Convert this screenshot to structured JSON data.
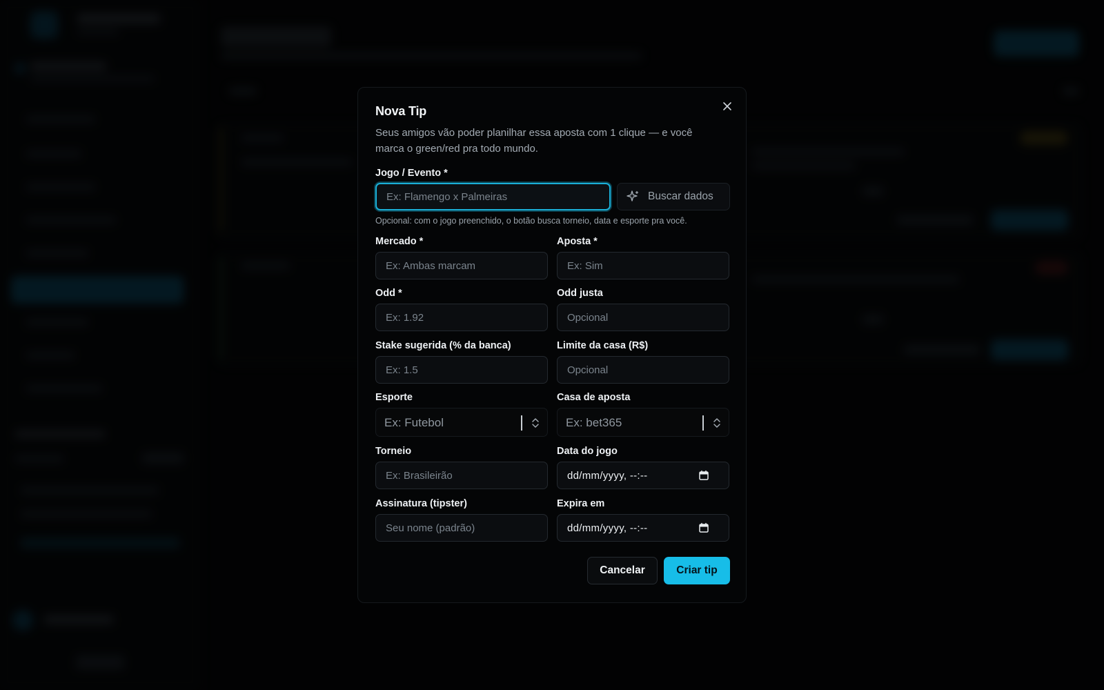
{
  "modal": {
    "title": "Nova Tip",
    "description": "Seus amigos vão poder planilhar essa aposta com 1 clique — e você marca o green/red pra todo mundo."
  },
  "fields": {
    "event": {
      "label": "Jogo / Evento *",
      "placeholder": "Ex: Flamengo x Palmeiras"
    },
    "search_button": "Buscar dados",
    "hint": "Opcional: com o jogo preenchido, o botão busca torneio, data e esporte pra você.",
    "market": {
      "label": "Mercado *",
      "placeholder": "Ex: Ambas marcam"
    },
    "bet": {
      "label": "Aposta *",
      "placeholder": "Ex: Sim"
    },
    "odd": {
      "label": "Odd *",
      "placeholder": "Ex: 1.92"
    },
    "fair_odd": {
      "label": "Odd justa",
      "placeholder": "Opcional"
    },
    "stake": {
      "label": "Stake sugerida (% da banca)",
      "placeholder": "Ex: 1.5"
    },
    "limit": {
      "label": "Limite da casa (R$)",
      "placeholder": "Opcional"
    },
    "sport": {
      "label": "Esporte",
      "placeholder": "Ex: Futebol"
    },
    "bookmaker": {
      "label": "Casa de aposta",
      "placeholder": "Ex: bet365"
    },
    "tournament": {
      "label": "Torneio",
      "placeholder": "Ex: Brasileirão"
    },
    "game_date": {
      "label": "Data do jogo",
      "value": "dd/mm/yyyy, --:--"
    },
    "signature": {
      "label": "Assinatura (tipster)",
      "placeholder": "Seu nome (padrão)"
    },
    "expires": {
      "label": "Expira em",
      "value": "dd/mm/yyyy, --:--"
    }
  },
  "actions": {
    "cancel": "Cancelar",
    "create": "Criar tip"
  },
  "colors": {
    "accent": "#17bde8",
    "background": "#050607",
    "modal": "#040506"
  },
  "icons": [
    "close-icon",
    "sparkle-icon",
    "chevron-updown-icon",
    "calendar-icon"
  ]
}
